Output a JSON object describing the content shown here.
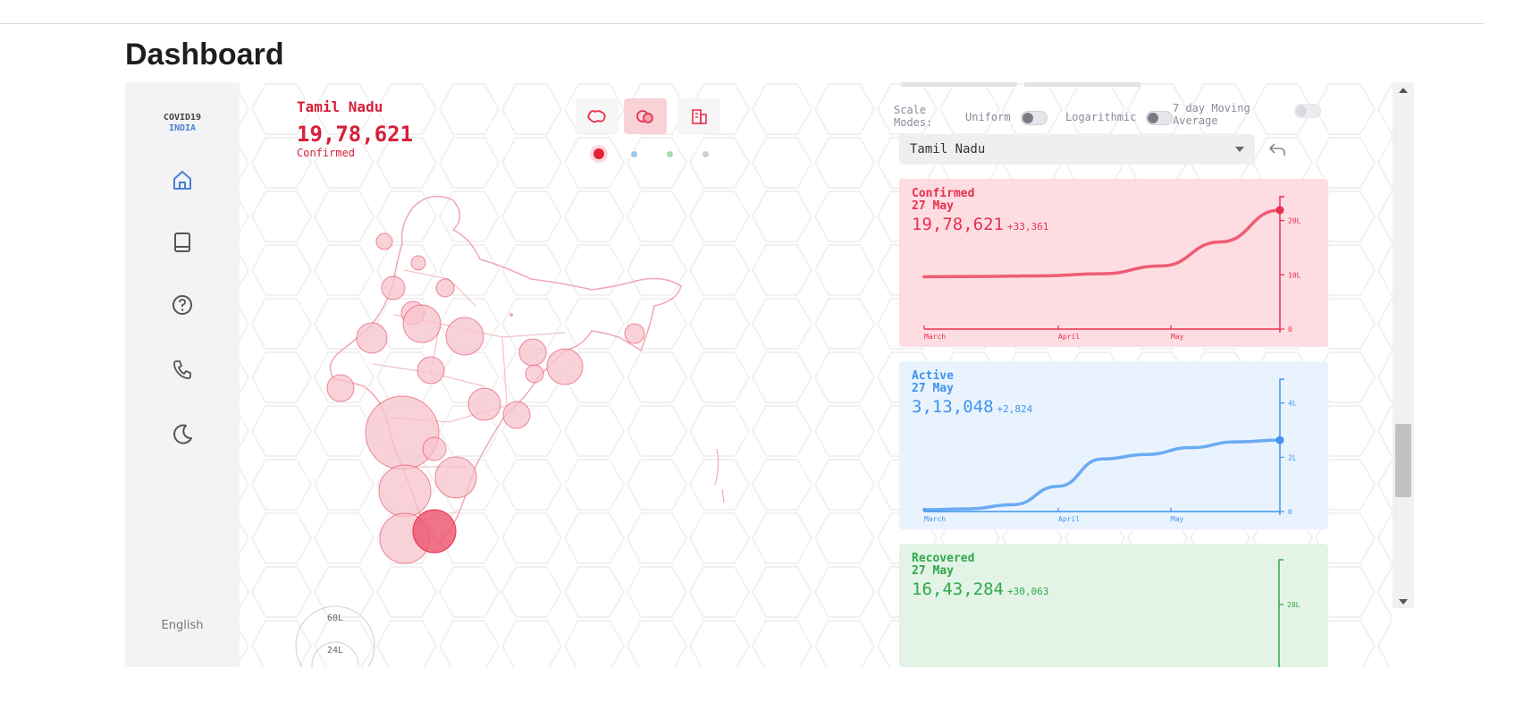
{
  "page": {
    "title": "Dashboard"
  },
  "sidebar": {
    "brand_top": "COVID19",
    "brand_bottom": "INDIA",
    "items": [
      {
        "icon": "home-icon"
      },
      {
        "icon": "book-icon"
      },
      {
        "icon": "help-icon"
      },
      {
        "icon": "phone-icon"
      },
      {
        "icon": "moon-icon"
      }
    ],
    "language": "English",
    "active_color": "#4a7fd4"
  },
  "map": {
    "state": "Tamil Nadu",
    "value": "19,78,621",
    "label": "Confirmed",
    "accent": "#d6203a",
    "view_buttons": [
      {
        "icon": "choropleth-map-icon",
        "active": false
      },
      {
        "icon": "bubble-map-icon",
        "active": true
      },
      {
        "icon": "district-buildings-icon",
        "active": false
      }
    ],
    "statistic_dots": [
      {
        "color": "#e8203a",
        "active": true
      },
      {
        "color": "#9ec7f3",
        "active": false
      },
      {
        "color": "#a6dcb0",
        "active": false
      },
      {
        "color": "#cfcfd6",
        "active": false
      }
    ],
    "legend": [
      "60L",
      "24L"
    ]
  },
  "controls": {
    "scale_modes_label": "Scale Modes:",
    "uniform_label": "Uniform",
    "log_label": "Logarithmic",
    "moving_avg_label": "7 day Moving Average",
    "uniform_on": false,
    "log_on": false,
    "moving_avg_on": false
  },
  "region_select": {
    "value": "Tamil Nadu"
  },
  "charts": [
    {
      "key": "confirmed",
      "title": "Confirmed",
      "date": "27 May",
      "value": "19,78,621",
      "delta": "+33,361",
      "bg": "#fddde2",
      "color": "#e8304e",
      "months": [
        "March",
        "April",
        "May"
      ],
      "yticks": [
        "0",
        "10L",
        "20L"
      ]
    },
    {
      "key": "active",
      "title": "Active",
      "date": "27 May",
      "value": "3,13,048",
      "delta": "+2,824",
      "bg": "#e9f3fe",
      "color": "#3f93ef",
      "months": [
        "March",
        "April",
        "May"
      ],
      "yticks": [
        "0",
        "2L",
        "4L"
      ]
    },
    {
      "key": "recovered",
      "title": "Recovered",
      "date": "27 May",
      "value": "16,43,284",
      "delta": "+30,063",
      "bg": "#e3f4e6",
      "color": "#2ea84a",
      "months": [],
      "yticks": [
        "20L"
      ]
    }
  ],
  "chart_data": [
    {
      "type": "line",
      "title": "Confirmed",
      "x": [
        "Mar 1",
        "Mar 15",
        "Apr 1",
        "Apr 15",
        "May 1",
        "May 15",
        "May 27"
      ],
      "y": [
        870000,
        875000,
        885000,
        920000,
        1050000,
        1450000,
        1978621
      ],
      "ylim": [
        0,
        2200000
      ],
      "yticks": [
        "0",
        "10L",
        "20L"
      ]
    },
    {
      "type": "line",
      "title": "Active",
      "x": [
        "Mar 1",
        "Mar 15",
        "Apr 1",
        "Apr 15",
        "May 1",
        "May 8",
        "May 15",
        "May 22",
        "May 27"
      ],
      "y": [
        8000,
        12000,
        30000,
        110000,
        230000,
        250000,
        280000,
        305000,
        313048
      ],
      "ylim": [
        0,
        580000
      ],
      "yticks": [
        "0",
        "2L",
        "4L"
      ]
    }
  ]
}
